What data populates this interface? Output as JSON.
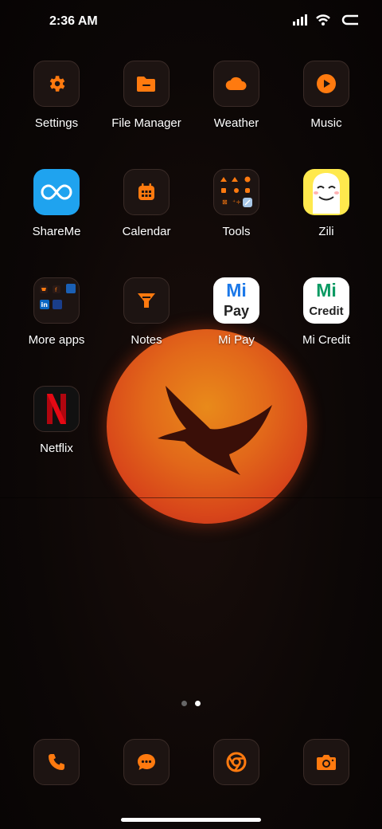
{
  "status": {
    "time": "2:36 AM"
  },
  "apps": [
    {
      "label": "Settings"
    },
    {
      "label": "File Manager"
    },
    {
      "label": "Weather"
    },
    {
      "label": "Music"
    },
    {
      "label": "ShareMe"
    },
    {
      "label": "Calendar"
    },
    {
      "label": "Tools"
    },
    {
      "label": "Zili"
    },
    {
      "label": "More apps"
    },
    {
      "label": "Notes"
    },
    {
      "label": "Mi Pay",
      "icon_text": [
        "Mi",
        "Pay"
      ]
    },
    {
      "label": "Mi Credit",
      "icon_text": [
        "Mi",
        "Credit"
      ]
    },
    {
      "label": "Netflix"
    }
  ],
  "dock": [
    {
      "icon": "phone-icon"
    },
    {
      "icon": "messages-icon"
    },
    {
      "icon": "chrome-icon"
    },
    {
      "icon": "camera-icon"
    }
  ],
  "pages": {
    "count": 2,
    "current": 2
  },
  "colors": {
    "accent": "#ff7a0f",
    "icon_bg": "#1d1412",
    "shareme": "#1fa3ef",
    "zili": "#ffe94d",
    "netflix": "#e50914",
    "mi_green": "#0a9a63",
    "mi_blue": "#1b78e8"
  }
}
